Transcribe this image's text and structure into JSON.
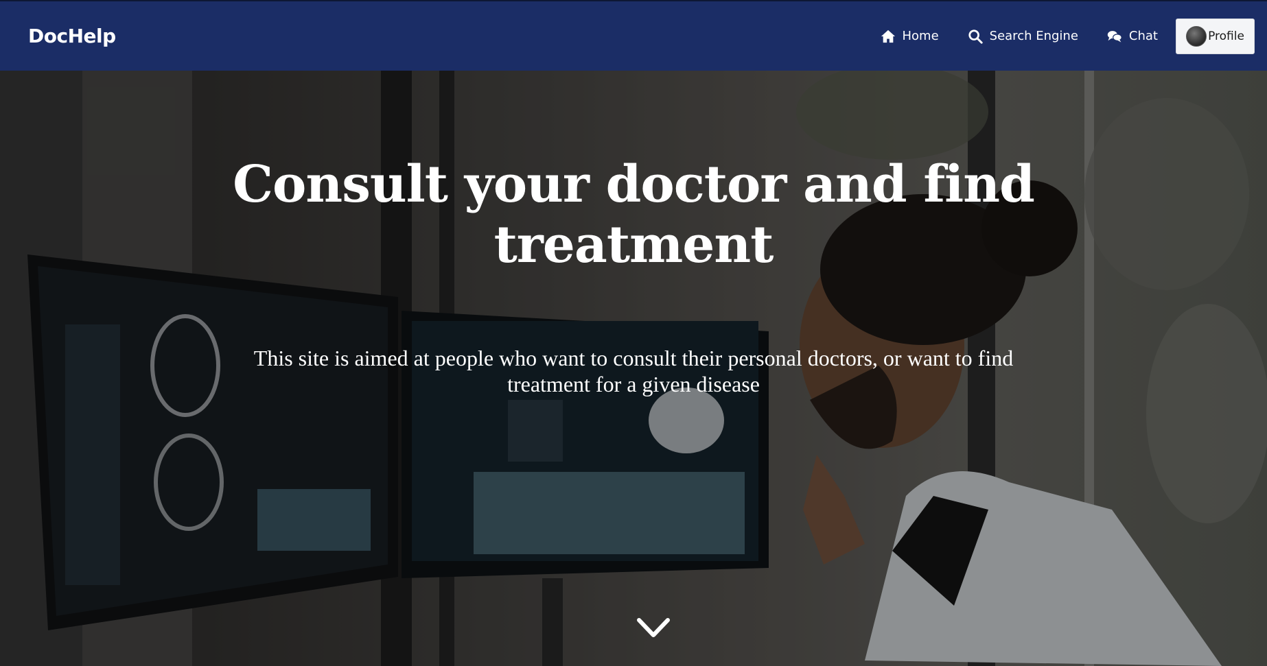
{
  "nav": {
    "brand": "DocHelp",
    "links": [
      {
        "label": "Home",
        "icon": "home-icon"
      },
      {
        "label": "Search Engine",
        "icon": "search-icon"
      },
      {
        "label": "Chat",
        "icon": "chat-icon"
      }
    ],
    "profile_label": "Profile"
  },
  "hero": {
    "title": "Consult your doctor and find treatment",
    "subtitle": "This site is aimed at people who want to consult their personal doctors, or want to find treatment for a given disease",
    "scroll_icon": "chevron-down-icon"
  },
  "colors": {
    "navbar": "#1b2d66",
    "text": "#ffffff",
    "profile_button": "#f4f5f7"
  }
}
